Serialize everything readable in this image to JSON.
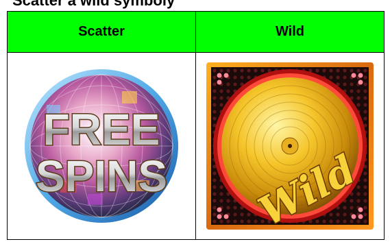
{
  "heading": "Scatter a wild symboly",
  "colors": {
    "header_bg": "#00ff00",
    "border": "#000000"
  },
  "table": {
    "columns": [
      {
        "header": "Scatter",
        "symbol": {
          "icon": "free-spins-disco-ball-icon",
          "text_line1": "FREE",
          "text_line2": "SPINS"
        }
      },
      {
        "header": "Wild",
        "symbol": {
          "icon": "wild-gold-vinyl-record-icon",
          "text": "Wild"
        }
      }
    ]
  }
}
